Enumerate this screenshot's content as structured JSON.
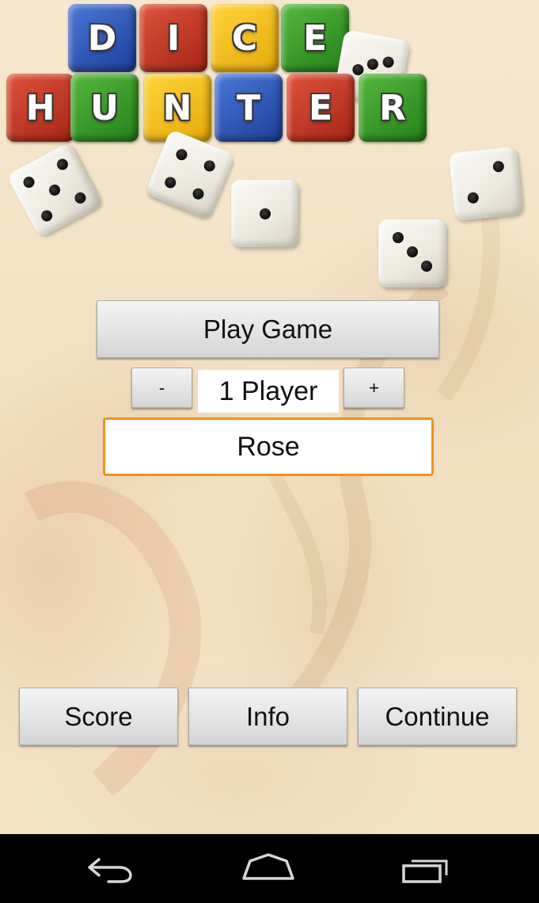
{
  "title": {
    "row1": [
      "D",
      "I",
      "C",
      "E"
    ],
    "row2": [
      "H",
      "U",
      "N",
      "T",
      "E",
      "R"
    ]
  },
  "menu": {
    "play_label": "Play Game",
    "minus_label": "-",
    "plus_label": "+",
    "player_count_text": "1 Player",
    "player_name_value": "Rose"
  },
  "bottom_buttons": {
    "score_label": "Score",
    "info_label": "Info",
    "continue_label": "Continue"
  },
  "nav_icons": [
    "back-icon",
    "home-icon",
    "recent-apps-icon"
  ],
  "colors": {
    "input_focus": "#f0911e",
    "tile_blue": "#2d55c0",
    "tile_red": "#c8391f",
    "tile_yellow": "#f6c21c",
    "tile_green": "#3a9a2a"
  }
}
